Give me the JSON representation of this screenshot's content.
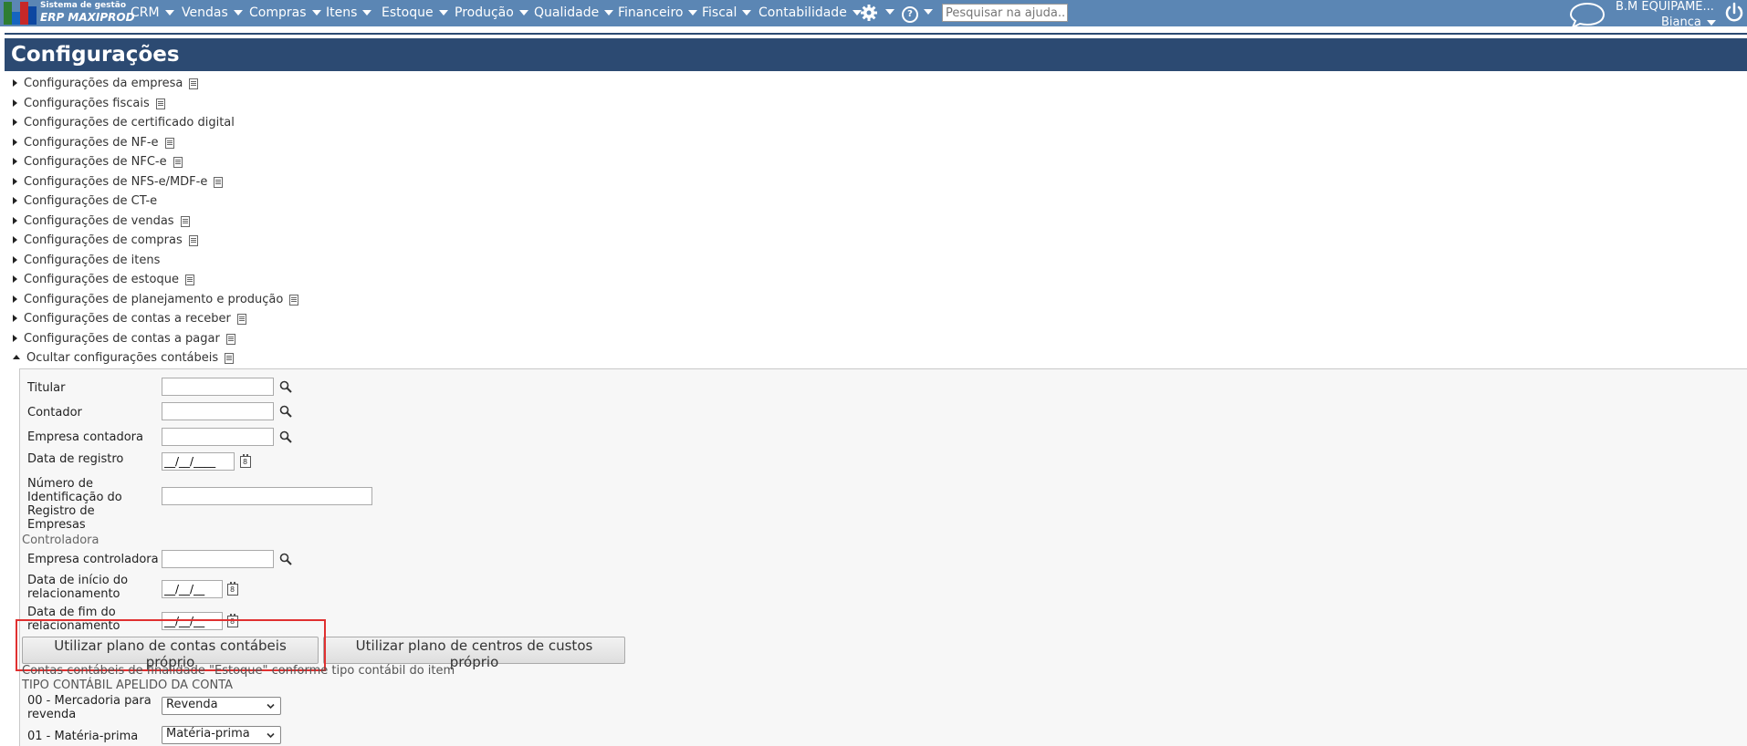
{
  "app": {
    "logo_line1": "Sistema de gestão",
    "logo_line2": "ERP MAXIPROD"
  },
  "nav": {
    "items": [
      "CRM",
      "Vendas",
      "Compras",
      "Itens",
      "Estoque",
      "Produção",
      "Qualidade",
      "Financeiro",
      "Fiscal",
      "Contabilidade"
    ],
    "search_placeholder": "Pesquisar na ajuda...",
    "help_glyph": "?",
    "company": "B.M EQUIPAME...",
    "user": "Bianca"
  },
  "page": {
    "title": "Configurações"
  },
  "config_sections": [
    {
      "label": "Configurações da empresa",
      "doc": true,
      "open": false
    },
    {
      "label": "Configurações fiscais",
      "doc": true,
      "open": false
    },
    {
      "label": "Configurações de certificado digital",
      "doc": false,
      "open": false
    },
    {
      "label": "Configurações de NF-e",
      "doc": true,
      "open": false
    },
    {
      "label": "Configurações de NFC-e",
      "doc": true,
      "open": false
    },
    {
      "label": "Configurações de NFS-e/MDF-e",
      "doc": true,
      "open": false
    },
    {
      "label": "Configurações de CT-e",
      "doc": false,
      "open": false
    },
    {
      "label": "Configurações de vendas",
      "doc": true,
      "open": false
    },
    {
      "label": "Configurações de compras",
      "doc": true,
      "open": false
    },
    {
      "label": "Configurações de itens",
      "doc": false,
      "open": false
    },
    {
      "label": "Configurações de estoque",
      "doc": true,
      "open": false
    },
    {
      "label": "Configurações de planejamento e produção",
      "doc": true,
      "open": false
    },
    {
      "label": "Configurações de contas a receber",
      "doc": true,
      "open": false
    },
    {
      "label": "Configurações de contas a pagar",
      "doc": true,
      "open": false
    },
    {
      "label": "Ocultar configurações contábeis",
      "doc": true,
      "open": true
    }
  ],
  "form": {
    "titular_label": "Titular",
    "contador_label": "Contador",
    "empresa_contadora_label": "Empresa contadora",
    "data_registro_label": "Data de registro",
    "data_registro_value": "__/__/____",
    "nire_label": "Número de Identificação do Registro de Empresas",
    "controladora_section": "Controladora",
    "empresa_controladora_label": "Empresa controladora",
    "data_inicio_label": "Data de início do relacionamento",
    "data_inicio_value": "__/__/__",
    "data_fim_label": "Data de fim do relacionamento",
    "data_fim_value": "__/__/__",
    "btn_plano_contas": "Utilizar plano de contas contábeis próprio",
    "btn_plano_centros": "Utilizar plano de centros de custos próprio",
    "note_estoque": "Contas contábeis de finalidade \"Estoque\" conforme tipo contábil do item",
    "tipo_header": "TIPO CONTÁBIL APELIDO DA CONTA",
    "tipo_00_label": "00 - Mercadoria para revenda",
    "tipo_00_value": "Revenda",
    "tipo_01_label": "01 - Matéria-prima",
    "tipo_01_value": "Matéria-prima"
  }
}
